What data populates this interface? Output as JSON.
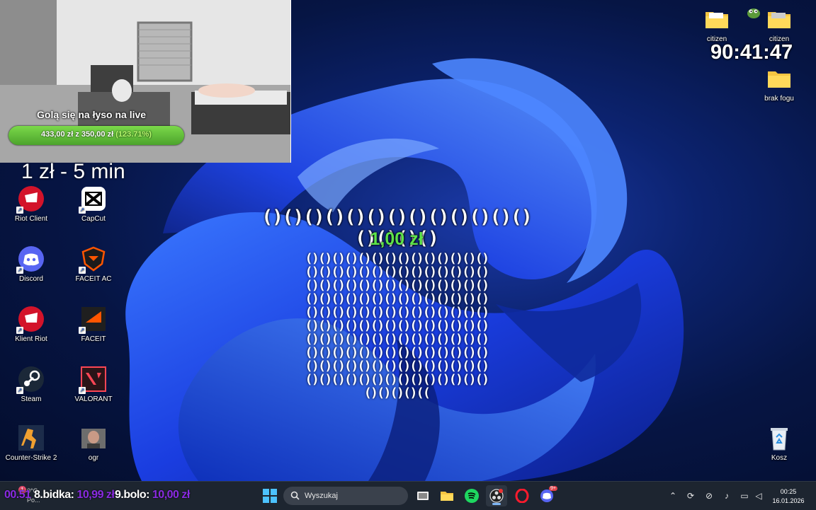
{
  "stream": {
    "goal_title": "Golą się na łyso na live",
    "goal_current": "433,00 zł",
    "goal_separator": "z",
    "goal_target": "350,00 zł",
    "goal_percent": "(123.71%)",
    "goal_fill_fraction": 1.0,
    "rate_text": "1 zł - 5 min",
    "timer": "90:41:47"
  },
  "donation": {
    "header": "()()()()()()()()()()()()()()()()()",
    "amount": "1,00 zł",
    "message": "()()()()()()()()()()()()()()()()()()()()()()()()()()()()()()()()()()()()()()()()()()()()()()()()()()()()()()()()()()()()()()()()()()()()()()()()()()()()()()()()()()()()()()()()()()()()()()()()()()()()()()()()()()()()()()()()()()()()()()()()()()()()()()()()()()()()()()()()()()()()()()()()(("
  },
  "desktop_icons": {
    "riot_client": "Riot Client",
    "capcut": "CapCut",
    "discord": "Discord",
    "faceit_ac": "FACEIT AC",
    "klient_riot": "Klient Riot",
    "faceit": "FACEIT",
    "steam": "Steam",
    "valorant": "VALORANT",
    "cs2": "Counter-Strike 2",
    "ogr": "ogr",
    "citizen1": "citizen",
    "citizen2": "citizen",
    "brak_fogu": "brak fogu",
    "kosz": "Kosz"
  },
  "taskbar": {
    "ticker_partial": "00.51",
    "ticker_8_label": "8.bidka:",
    "ticker_8_amount": "10,99 zł",
    "ticker_9_label": "9.bolo:",
    "ticker_9_amount": "10,00 zł",
    "weather_temp": "0°C",
    "weather_badge": "1",
    "weather_sub": "Po...",
    "search_placeholder": "Wyszukaj",
    "time": "00:25",
    "date": "16.01.2026",
    "discord_badge": "9+"
  },
  "colors": {
    "goal_fill": "#5cc23a",
    "donation_amount": "#5de34a",
    "ticker_amount": "#8a2be2",
    "taskbar_bg": "#1d2530"
  }
}
